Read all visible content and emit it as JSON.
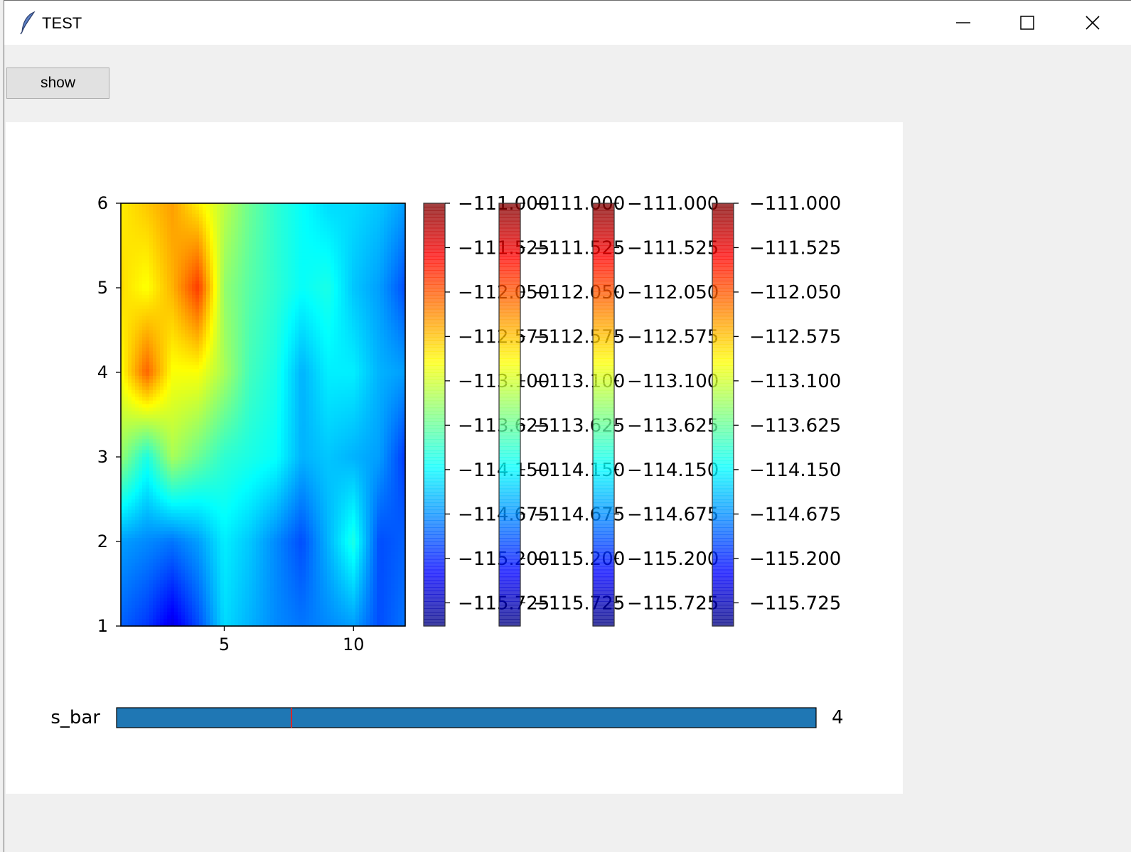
{
  "window": {
    "title": "TEST"
  },
  "toolbar": {
    "show_label": "show"
  },
  "colors": {
    "accent": "#1f77b4",
    "slider_marker": "#d62728"
  },
  "icons": [
    "feather-icon",
    "minimize-icon",
    "maximize-icon",
    "close-icon"
  ],
  "chart_data": {
    "type": "heatmap",
    "title": "",
    "xlabel": "",
    "ylabel": "",
    "x_ticks": [
      5,
      10
    ],
    "y_ticks": [
      1,
      2,
      3,
      4,
      5,
      6
    ],
    "xlim": [
      1,
      12
    ],
    "ylim": [
      1,
      6
    ],
    "colormap": "jet",
    "x": [
      1,
      2,
      3,
      4,
      5,
      6,
      7,
      8,
      9,
      10,
      11,
      12
    ],
    "y": [
      1,
      2,
      3,
      4,
      5,
      6
    ],
    "z": [
      [
        -114.9,
        -115.1,
        -115.5,
        -115.0,
        -114.3,
        -114.5,
        -114.7,
        -114.8,
        -114.7,
        -114.6,
        -115.0,
        -114.8
      ],
      [
        -114.6,
        -114.7,
        -114.8,
        -114.6,
        -114.2,
        -114.4,
        -114.7,
        -115.0,
        -114.5,
        -114.0,
        -115.0,
        -114.9
      ],
      [
        -113.4,
        -114.0,
        -113.3,
        -113.6,
        -113.9,
        -114.0,
        -114.1,
        -114.5,
        -114.4,
        -114.5,
        -114.6,
        -115.1
      ],
      [
        -112.9,
        -112.1,
        -112.9,
        -112.9,
        -113.3,
        -113.8,
        -114.0,
        -114.5,
        -114.2,
        -114.2,
        -114.5,
        -114.6
      ],
      [
        -112.7,
        -112.9,
        -112.5,
        -111.9,
        -113.4,
        -113.7,
        -113.9,
        -114.1,
        -114.0,
        -114.4,
        -114.6,
        -115.0
      ],
      [
        -112.8,
        -112.6,
        -112.4,
        -112.8,
        -113.2,
        -113.6,
        -113.9,
        -114.1,
        -114.3,
        -114.3,
        -114.4,
        -114.6
      ]
    ],
    "colorbars": [
      {
        "ticks": [
          "−111.000",
          "−111.525",
          "−112.050",
          "−112.575",
          "−113.100",
          "−113.625",
          "−114.150",
          "−114.675",
          "−115.200",
          "−115.725"
        ]
      },
      {
        "ticks": [
          "−111.000",
          "−111.525",
          "−112.050",
          "−112.575",
          "−113.100",
          "−113.625",
          "−114.150",
          "−114.675",
          "−115.200",
          "−115.725"
        ]
      },
      {
        "ticks": [
          "−111.000",
          "−111.525",
          "−112.050",
          "−112.575",
          "−113.100",
          "−113.625",
          "−114.150",
          "−114.675",
          "−115.200",
          "−115.725"
        ]
      },
      {
        "ticks": [
          "−111.000",
          "−111.525",
          "−112.050",
          "−112.575",
          "−113.100",
          "−113.625",
          "−114.150",
          "−114.675",
          "−115.200",
          "−115.725"
        ]
      }
    ],
    "colorbar_range": [
      -116.0,
      -111.0
    ],
    "slider": {
      "label": "s_bar",
      "value": 4,
      "valmin": 0,
      "valmax": 16,
      "valmin_marker": 4,
      "value_text": "4"
    }
  }
}
